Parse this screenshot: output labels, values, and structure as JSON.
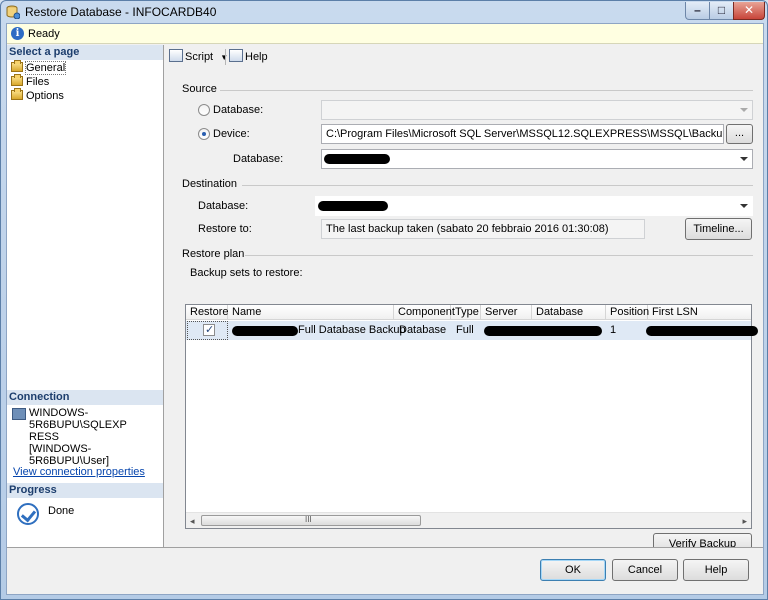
{
  "window": {
    "title": "Restore Database - INFOCARDB40",
    "min_glyph": "–",
    "max_glyph": "□",
    "close_glyph": "✕"
  },
  "status": {
    "text": "Ready"
  },
  "left_panel": {
    "select_page_header": "Select a page",
    "pages": [
      {
        "label": "General"
      },
      {
        "label": "Files"
      },
      {
        "label": "Options"
      }
    ],
    "connection_header": "Connection",
    "connection_lines": [
      "WINDOWS-5R6BUPU\\SQLEXP",
      "RESS",
      "[WINDOWS-5R6BUPU\\User]"
    ],
    "connection_link": "View connection properties",
    "progress_header": "Progress",
    "progress_status": "Done"
  },
  "toolbar": {
    "script_label": "Script",
    "help_label": "Help"
  },
  "source": {
    "header": "Source",
    "database_radio_label": "Database:",
    "device_radio_label": "Device:",
    "device_path": "C:\\Program Files\\Microsoft SQL Server\\MSSQL12.SQLEXPRESS\\MSSQL\\Backup\\BD_AC_E_",
    "browse_label": "...",
    "database_label": "Database:"
  },
  "destination": {
    "header": "Destination",
    "database_label": "Database:",
    "restore_to_label": "Restore to:",
    "restore_to_value": "The last backup taken (sabato 20 febbraio 2016 01:30:08)",
    "timeline_label": "Timeline..."
  },
  "restore_plan": {
    "header": "Restore plan",
    "backup_sets_label": "Backup sets to restore:",
    "columns": [
      "Restore",
      "Name",
      "Component",
      "Type",
      "Server",
      "Database",
      "Position",
      "First LSN"
    ],
    "rows": [
      {
        "restore": true,
        "name": "Full Database Backup",
        "component": "Database",
        "type": "Full",
        "position": "1"
      }
    ],
    "scroll_grip": "III",
    "scroll_left": "◂",
    "scroll_right": "▸",
    "verify_label": "Verify Backup Media"
  },
  "footer": {
    "ok_label": "OK",
    "cancel_label": "Cancel",
    "help_label": "Help"
  },
  "colors": {
    "section_header_bg": "#dbe5f1",
    "selected_row_bg": "#dfe9f5",
    "link": "#0645ad"
  }
}
